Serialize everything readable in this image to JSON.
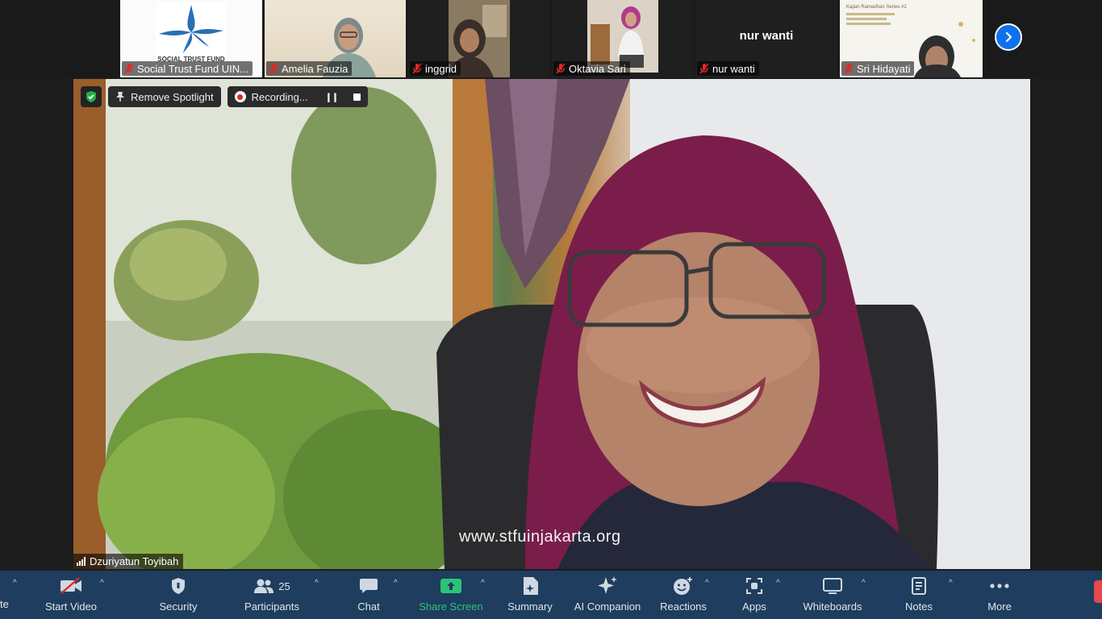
{
  "thumbnails": [
    {
      "name": "Social Trust Fund UIN...",
      "logo_text": "SOCIAL TRUST FUND"
    },
    {
      "name": "Amelia Fauzia"
    },
    {
      "name": "inggrid"
    },
    {
      "name": "Oktavia Sari"
    },
    {
      "name": "nur wanti",
      "big_name": "nur wanti"
    },
    {
      "name": "Sri Hidayati",
      "slide_title": "Kajian Ramadhan Series #2"
    }
  ],
  "main": {
    "remove_spotlight": "Remove Spotlight",
    "recording": "Recording...",
    "watermark": "www.stfuinjakarta.org",
    "speaker_name": "Dzuriyatun Toyibah"
  },
  "toolbar": {
    "edge_text": "te",
    "start_video": "Start Video",
    "security": "Security",
    "participants": "Participants",
    "participants_count": "25",
    "chat": "Chat",
    "share_screen": "Share Screen",
    "summary": "Summary",
    "ai_companion": "AI Companion",
    "reactions": "Reactions",
    "apps": "Apps",
    "whiteboards": "Whiteboards",
    "notes": "Notes",
    "more": "More"
  },
  "colors": {
    "toolbar_bg": "#1f3d5e",
    "share_green": "#2ac476",
    "mute_red": "#e02828",
    "next_blue": "#0e72ed"
  }
}
